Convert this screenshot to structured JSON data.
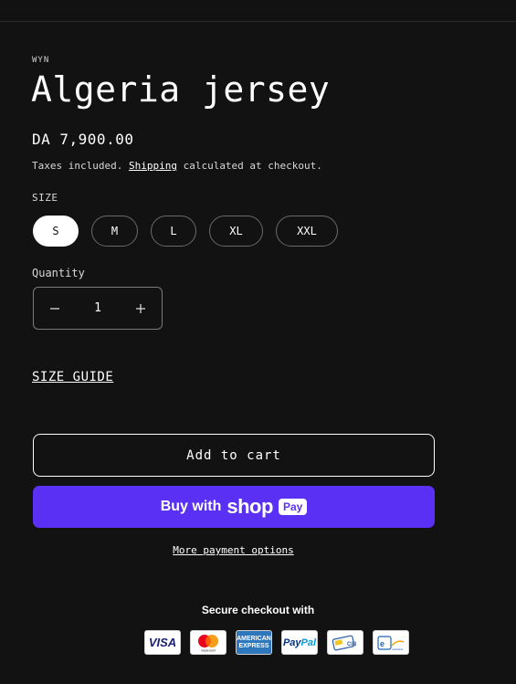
{
  "product": {
    "vendor": "WYN",
    "title": "Algeria jersey",
    "price": "DA 7,900.00",
    "tax_prefix": "Taxes included.",
    "shipping_link": "Shipping",
    "tax_suffix": "calculated at checkout."
  },
  "size": {
    "label": "SIZE",
    "options": [
      "S",
      "M",
      "L",
      "XL",
      "XXL"
    ],
    "selected": "S"
  },
  "quantity": {
    "label": "Quantity",
    "value": "1",
    "decrease_icon": "minus-icon",
    "increase_icon": "plus-icon"
  },
  "size_guide": "SIZE GUIDE",
  "buttons": {
    "add_to_cart": "Add to cart",
    "buy_with": "Buy with",
    "shop_word": "shop",
    "pay_badge": "Pay",
    "more_payment": "More payment options"
  },
  "checkout": {
    "secure_label": "Secure checkout with",
    "cards": [
      "VISA",
      "mastercard",
      "AMERICAN EXPRESS",
      "PayPal",
      "CIB",
      "edahabia"
    ]
  },
  "colors": {
    "background": "#121212",
    "shop_pay": "#5a31f4",
    "text": "#ffffff"
  }
}
